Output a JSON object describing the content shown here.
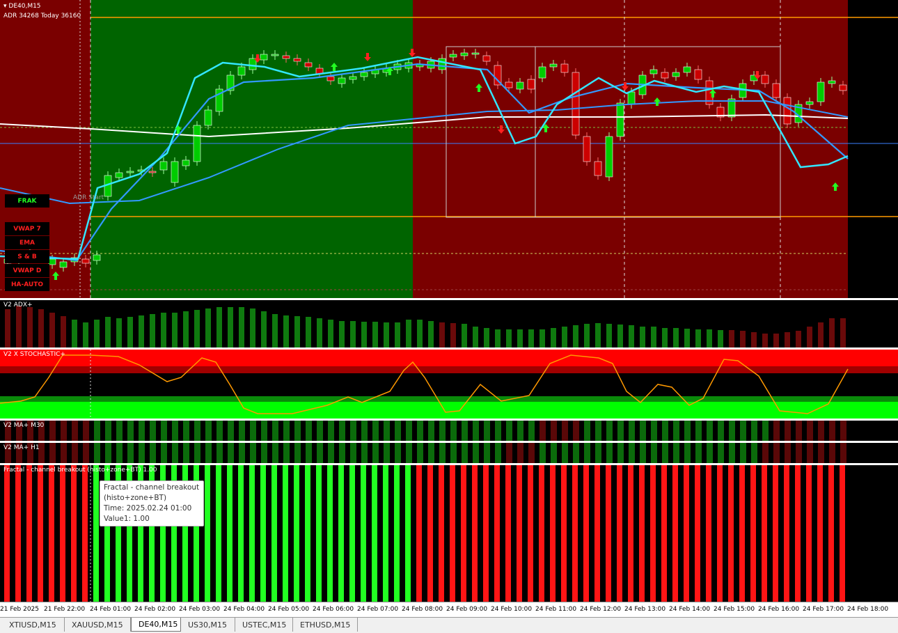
{
  "header": {
    "symbol": "DE40,M15",
    "adr_line": "ADR 34268  Today 36160"
  },
  "buttons": {
    "frak": "FRAK",
    "vwap7": "VWAP 7",
    "ema": "EMA",
    "sb": "S & B",
    "vwapd": "VWAP D",
    "haauto": "HA-AUTO"
  },
  "adr_start_label": "ADR Start",
  "panes": {
    "adx": "V2 ADX+",
    "stoch": "V2 X STOCHASTIC+",
    "ma30": "V2 MA+ M30",
    "mah1": "V2 MA+ H1",
    "fractal": "Fractal - channel breakout (histo+zone+BT) 1.00"
  },
  "tooltip": {
    "line1": "Fractal - channel breakout",
    "line2": "(histo+zone+BT)",
    "line3": "Time: 2025.02.24 01:00",
    "line4": "Value1: 1.00"
  },
  "time_labels": [
    "21 Feb 2025",
    "21 Feb 22:00",
    "24 Feb 01:00",
    "24 Feb 02:00",
    "24 Feb 03:00",
    "24 Feb 04:00",
    "24 Feb 05:00",
    "24 Feb 06:00",
    "24 Feb 07:00",
    "24 Feb 08:00",
    "24 Feb 09:00",
    "24 Feb 10:00",
    "24 Feb 11:00",
    "24 Feb 12:00",
    "24 Feb 13:00",
    "24 Feb 14:00",
    "24 Feb 15:00",
    "24 Feb 16:00",
    "24 Feb 17:00",
    "24 Feb 18:00"
  ],
  "tabs": [
    "XTIUSD,M15",
    "XAUUSD,M15",
    "DE40,M15",
    "US30,M15",
    "USTEC,M15",
    "ETHUSD,M15"
  ],
  "active_tab": "DE40,M15",
  "colors": {
    "bull_zone": "#006400",
    "bear_zone": "#7a0000",
    "candle_up": "#00cc00",
    "candle_down": "#cc0000",
    "ma_fast": "#33e6ff",
    "ma_slow": "#3399ff",
    "ma_long": "#ffffff",
    "stoch": "#ff9900",
    "adr_line": "#ff9900"
  }
}
